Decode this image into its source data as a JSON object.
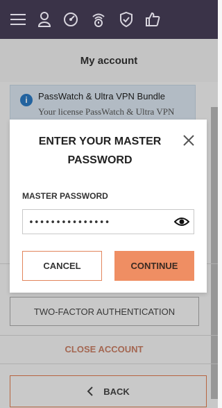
{
  "header": {
    "icons": [
      "menu-icon",
      "user-icon",
      "speedometer-icon",
      "wifi-icon",
      "shield-icon",
      "thumbs-up-icon"
    ],
    "title": "My account"
  },
  "info": {
    "title": "PassWatch & Ultra VPN Bundle",
    "text": "Your license PassWatch & Ultra VPN"
  },
  "buttons": {
    "two_factor": "TWO-FACTOR AUTHENTICATION",
    "close_account": "CLOSE ACCOUNT",
    "back": "BACK"
  },
  "modal": {
    "title_line1": "ENTER YOUR MASTER",
    "title_line2": "PASSWORD",
    "field_label": "MASTER PASSWORD",
    "password_value": "•••••••••••••••",
    "cancel": "CANCEL",
    "continue": "CONTINUE"
  },
  "colors": {
    "topbar": "#3a3348",
    "accent": "#ef8e63",
    "info_bg": "#d9e5ef"
  }
}
